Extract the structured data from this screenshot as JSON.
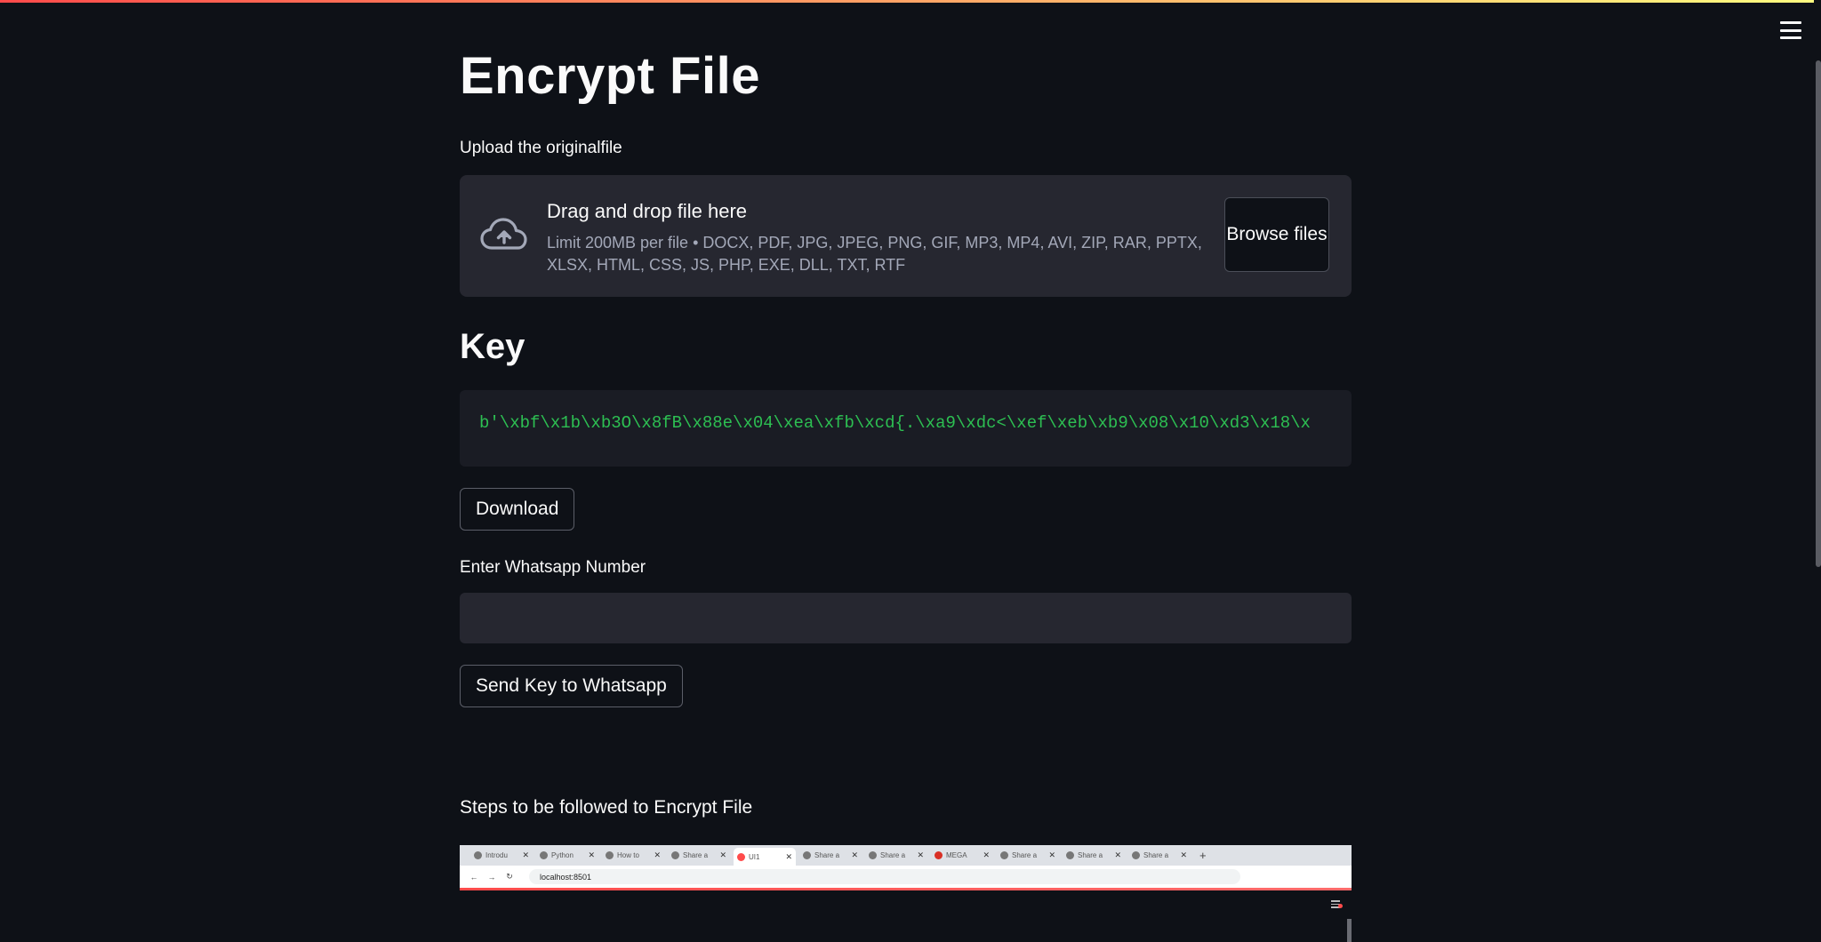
{
  "page": {
    "title": "Encrypt File",
    "upload_label": "Upload the originalfile",
    "uploader": {
      "drag_title": "Drag and drop file here",
      "limits": "Limit 200MB per file • DOCX, PDF, JPG, JPEG, PNG, GIF, MP3, MP4, AVI, ZIP, RAR, PPTX, XLSX, HTML, CSS, JS, PHP, EXE, DLL, TXT, RTF",
      "browse_label": "Browse files"
    },
    "key_heading": "Key",
    "key_value": "b'\\xbf\\x1b\\xb3O\\x8fB\\x88e\\x04\\xea\\xfb\\xcd{.\\xa9\\xdc<\\xef\\xeb\\xb9\\x08\\x10\\xd3\\x18\\x",
    "download_label": "Download",
    "whatsapp_label": "Enter Whatsapp Number",
    "whatsapp_value": "",
    "send_label": "Send Key to Whatsapp",
    "steps_label": "Steps to be followed to Encrypt File",
    "embedded_screenshot": {
      "tabs": [
        "Introdu",
        "Python",
        "How to",
        "Share a",
        "UI1",
        "Share a",
        "Share a",
        "MEGA",
        "Share a",
        "Share a",
        "Share a"
      ],
      "address": "localhost:8501"
    }
  },
  "colors": {
    "background": "#0e1117",
    "panel": "#262730",
    "code_green": "#2dbf52",
    "accent_gradient_start": "#ff4b4b",
    "accent_gradient_end": "#fffd80"
  },
  "icons": {
    "menu": "hamburger-menu-icon",
    "upload": "cloud-upload-icon"
  }
}
